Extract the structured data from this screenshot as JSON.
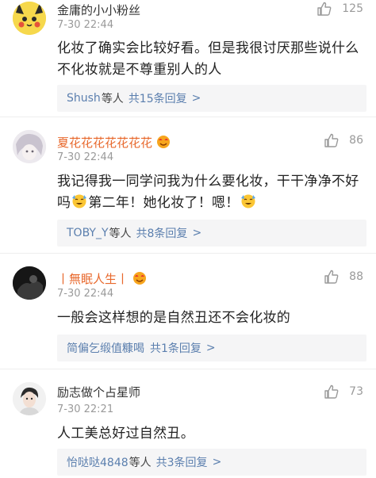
{
  "comments": [
    {
      "username": "金庸的小小粉丝",
      "time": "7-30 22:44",
      "likes": "125",
      "text": "化妆了确实会比较好看。但是我很讨厌那些说什么不化妆就是不尊重别人的人",
      "reply_names": "Shush",
      "reply_mid": "等人",
      "reply_count": "共15条回复",
      "reply_chevron": ">"
    },
    {
      "username": "夏花花花花花花花",
      "time": "7-30 22:44",
      "likes": "86",
      "text_part1": "我记得我一同学问我为什么要化妆，干干净净不好吗",
      "text_part2": "第二年！她化妆了！嗯！",
      "reply_names": "TOBY_Y",
      "reply_mid": "等人",
      "reply_count": "共8条回复",
      "reply_chevron": ">"
    },
    {
      "username": "丨無眠人生丨",
      "time": "7-30 22:44",
      "likes": "88",
      "text": "一般会这样想的是自然丑还不会化妆的",
      "reply_names": "简偏乞缎值糠喝",
      "reply_mid": "",
      "reply_count": "共1条回复",
      "reply_chevron": ">"
    },
    {
      "username": "励志做个占星师",
      "time": "7-30 22:21",
      "likes": "73",
      "text": "人工美总好过自然丑。",
      "reply_names": "怡哒哒4848",
      "reply_mid": "等人",
      "reply_count": "共3条回复",
      "reply_chevron": ">"
    }
  ],
  "icons": {
    "like": "thumbs-up-icon",
    "emoji": "sweat-smile-emoji-icon",
    "badge": "vip-face-badge-icon"
  },
  "colors": {
    "link": "#5b7fae",
    "vip_name": "#e8682c",
    "meta": "#9a9a9a",
    "reply_bg": "#f5f5f6"
  }
}
